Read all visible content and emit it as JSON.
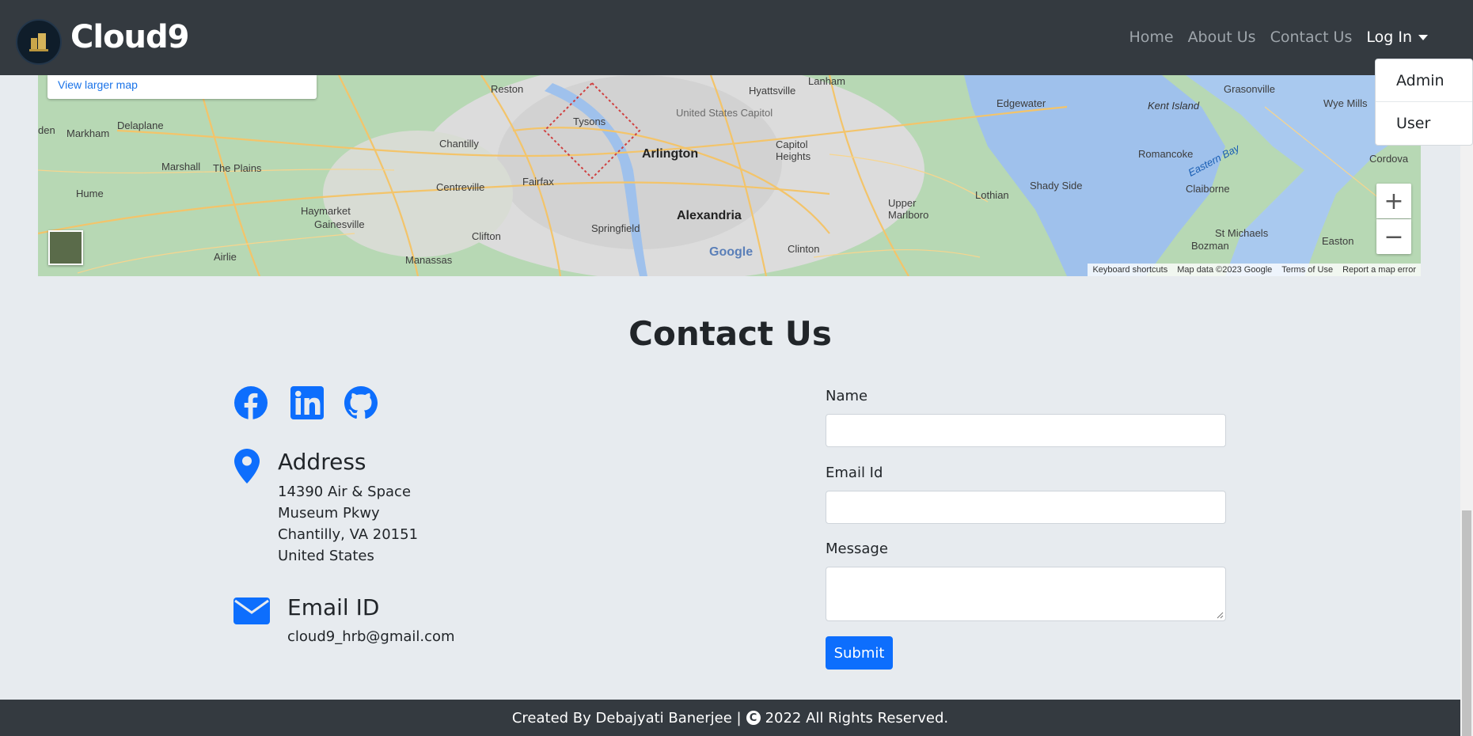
{
  "navbar": {
    "brand": "Cloud9",
    "links": [
      "Home",
      "About Us",
      "Contact Us"
    ],
    "login": "Log In"
  },
  "dropdown": {
    "items": [
      "Admin",
      "User"
    ]
  },
  "map": {
    "view_larger": "View larger map",
    "labels": {
      "reston": "Reston",
      "delaplane": "Delaplane",
      "markham": "Markham",
      "marshall": "Marshall",
      "plains": "The Plains",
      "hume": "Hume",
      "haymarket": "Haymarket",
      "gainesville": "Gainesville",
      "airlie": "Airlie",
      "manassas": "Manassas",
      "clifton": "Clifton",
      "centreville": "Centreville",
      "chantilly": "Chantilly",
      "fairfax": "Fairfax",
      "tysons": "Tysons",
      "arlington": "Arlington",
      "alexandria": "Alexandria",
      "springfield": "Springfield",
      "hyattsville": "Hyattsville",
      "capitol": "United States Capitol",
      "capitol_heights": "Capitol\nHeights",
      "lanham": "Lanham",
      "clinton": "Clinton",
      "upper_marlboro": "Upper\nMarlboro",
      "edgewater": "Edgewater",
      "lothian": "Lothian",
      "shady_side": "Shady Side",
      "kent_island": "Kent Island",
      "grasonville": "Grasonville",
      "wye_mills": "Wye Mills",
      "romancoke": "Romancoke",
      "eastern_bay": "Eastern Bay",
      "claiborne": "Claiborne",
      "st_michaels": "St Michaels",
      "bozman": "Bozman",
      "easton": "Easton",
      "cordova": "Cordova",
      "den": "den"
    },
    "google": "Google",
    "footer": [
      "Keyboard shortcuts",
      "Map data ©2023 Google",
      "Terms of Use",
      "Report a map error"
    ],
    "zoom_in": "+",
    "zoom_out": "−"
  },
  "contact": {
    "title": "Contact Us",
    "address_title": "Address",
    "address_lines": [
      "14390 Air & Space",
      "Museum Pkwy",
      "Chantilly, VA 20151",
      "United States"
    ],
    "email_title": "Email ID",
    "email": "cloud9_hrb@gmail.com"
  },
  "form": {
    "name_label": "Name",
    "email_label": "Email Id",
    "message_label": "Message",
    "name_value": "",
    "email_value": "",
    "message_value": "",
    "submit": "Submit"
  },
  "footer": {
    "text_before": "Created By Debajyati Banerjee |",
    "copy_symbol": "C",
    "text_after": "2022 All Rights Reserved."
  },
  "colors": {
    "navbar": "#343a40",
    "primary": "#0d6efd",
    "background": "#e7ebef"
  }
}
